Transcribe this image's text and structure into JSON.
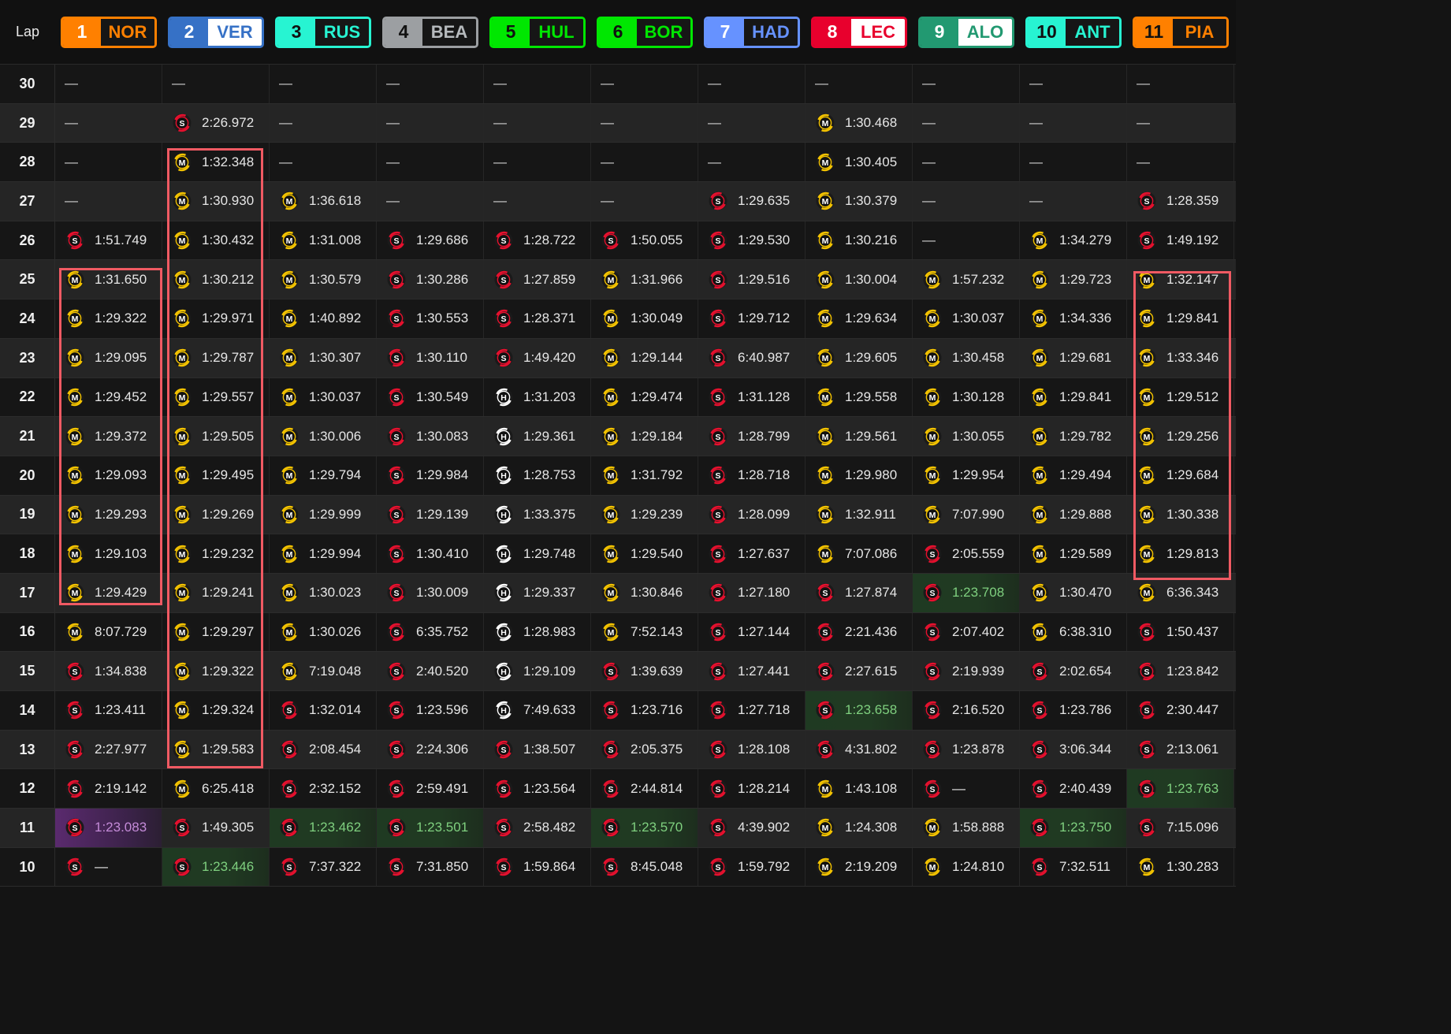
{
  "header": {
    "lap_label": "Lap"
  },
  "tyre_colors": {
    "S": "#e8102e",
    "M": "#f5c400",
    "H": "#ffffff"
  },
  "drivers": [
    {
      "pos": "1",
      "code": "NOR",
      "color": "#ff8000",
      "pos_text": "#ffffff",
      "code_text": "#ff8000"
    },
    {
      "pos": "2",
      "code": "VER",
      "color": "#3671c6",
      "pos_text": "#ffffff",
      "code_text": "#3671c6",
      "code_bg": "#ffffff"
    },
    {
      "pos": "3",
      "code": "RUS",
      "color": "#27f4d2",
      "pos_text": "#111111",
      "code_text": "#27f4d2"
    },
    {
      "pos": "4",
      "code": "BEA",
      "color": "#9c9fa2",
      "pos_text": "#111111",
      "code_text": "#b6babd"
    },
    {
      "pos": "5",
      "code": "HUL",
      "color": "#00e701",
      "pos_text": "#111111",
      "code_text": "#00e701"
    },
    {
      "pos": "6",
      "code": "BOR",
      "color": "#00e701",
      "pos_text": "#111111",
      "code_text": "#00e701"
    },
    {
      "pos": "7",
      "code": "HAD",
      "color": "#6692ff",
      "pos_text": "#ffffff",
      "code_text": "#6692ff"
    },
    {
      "pos": "8",
      "code": "LEC",
      "color": "#e8002d",
      "pos_text": "#ffffff",
      "code_text": "#e8002d",
      "code_bg": "#ffffff"
    },
    {
      "pos": "9",
      "code": "ALO",
      "color": "#229971",
      "pos_text": "#ffffff",
      "code_text": "#229971",
      "code_bg": "#ffffff"
    },
    {
      "pos": "10",
      "code": "ANT",
      "color": "#27f4d2",
      "pos_text": "#111111",
      "code_text": "#27f4d2"
    },
    {
      "pos": "11",
      "code": "PIA",
      "color": "#ff8000",
      "pos_text": "#111111",
      "code_text": "#ff8000"
    }
  ],
  "laps": [
    {
      "lap": "30",
      "cells": [
        {
          "t": "—"
        },
        {
          "t": "—"
        },
        {
          "t": "—"
        },
        {
          "t": "—"
        },
        {
          "t": "—"
        },
        {
          "t": "—"
        },
        {
          "t": "—"
        },
        {
          "t": "—"
        },
        {
          "t": "—"
        },
        {
          "t": "—"
        },
        {
          "t": "—"
        }
      ]
    },
    {
      "lap": "29",
      "cells": [
        {
          "t": "—"
        },
        {
          "tyre": "S",
          "t": "2:26.972"
        },
        {
          "t": "—"
        },
        {
          "t": "—"
        },
        {
          "t": "—"
        },
        {
          "t": "—"
        },
        {
          "t": "—"
        },
        {
          "tyre": "M",
          "t": "1:30.468"
        },
        {
          "t": "—"
        },
        {
          "t": "—"
        },
        {
          "t": "—"
        }
      ]
    },
    {
      "lap": "28",
      "cells": [
        {
          "t": "—"
        },
        {
          "tyre": "M",
          "t": "1:32.348"
        },
        {
          "t": "—"
        },
        {
          "t": "—"
        },
        {
          "t": "—"
        },
        {
          "t": "—"
        },
        {
          "t": "—"
        },
        {
          "tyre": "M",
          "t": "1:30.405"
        },
        {
          "t": "—"
        },
        {
          "t": "—"
        },
        {
          "t": "—"
        }
      ]
    },
    {
      "lap": "27",
      "cells": [
        {
          "t": "—"
        },
        {
          "tyre": "M",
          "t": "1:30.930"
        },
        {
          "tyre": "M",
          "t": "1:36.618"
        },
        {
          "t": "—"
        },
        {
          "t": "—"
        },
        {
          "t": "—"
        },
        {
          "tyre": "S",
          "t": "1:29.635"
        },
        {
          "tyre": "M",
          "t": "1:30.379"
        },
        {
          "t": "—"
        },
        {
          "t": "—"
        },
        {
          "tyre": "S",
          "t": "1:28.359"
        }
      ]
    },
    {
      "lap": "26",
      "cells": [
        {
          "tyre": "S",
          "t": "1:51.749"
        },
        {
          "tyre": "M",
          "t": "1:30.432"
        },
        {
          "tyre": "M",
          "t": "1:31.008"
        },
        {
          "tyre": "S",
          "t": "1:29.686"
        },
        {
          "tyre": "S",
          "t": "1:28.722"
        },
        {
          "tyre": "S",
          "t": "1:50.055"
        },
        {
          "tyre": "S",
          "t": "1:29.530"
        },
        {
          "tyre": "M",
          "t": "1:30.216"
        },
        {
          "t": "—"
        },
        {
          "tyre": "M",
          "t": "1:34.279"
        },
        {
          "tyre": "S",
          "t": "1:49.192"
        }
      ]
    },
    {
      "lap": "25",
      "cells": [
        {
          "tyre": "M",
          "t": "1:31.650"
        },
        {
          "tyre": "M",
          "t": "1:30.212"
        },
        {
          "tyre": "M",
          "t": "1:30.579"
        },
        {
          "tyre": "S",
          "t": "1:30.286"
        },
        {
          "tyre": "S",
          "t": "1:27.859"
        },
        {
          "tyre": "M",
          "t": "1:31.966"
        },
        {
          "tyre": "S",
          "t": "1:29.516"
        },
        {
          "tyre": "M",
          "t": "1:30.004"
        },
        {
          "tyre": "M",
          "t": "1:57.232"
        },
        {
          "tyre": "M",
          "t": "1:29.723"
        },
        {
          "tyre": "M",
          "t": "1:32.147"
        }
      ]
    },
    {
      "lap": "24",
      "cells": [
        {
          "tyre": "M",
          "t": "1:29.322"
        },
        {
          "tyre": "M",
          "t": "1:29.971"
        },
        {
          "tyre": "M",
          "t": "1:40.892"
        },
        {
          "tyre": "S",
          "t": "1:30.553"
        },
        {
          "tyre": "S",
          "t": "1:28.371"
        },
        {
          "tyre": "M",
          "t": "1:30.049"
        },
        {
          "tyre": "S",
          "t": "1:29.712"
        },
        {
          "tyre": "M",
          "t": "1:29.634"
        },
        {
          "tyre": "M",
          "t": "1:30.037"
        },
        {
          "tyre": "M",
          "t": "1:34.336"
        },
        {
          "tyre": "M",
          "t": "1:29.841"
        }
      ]
    },
    {
      "lap": "23",
      "cells": [
        {
          "tyre": "M",
          "t": "1:29.095"
        },
        {
          "tyre": "M",
          "t": "1:29.787"
        },
        {
          "tyre": "M",
          "t": "1:30.307"
        },
        {
          "tyre": "S",
          "t": "1:30.110"
        },
        {
          "tyre": "S",
          "t": "1:49.420"
        },
        {
          "tyre": "M",
          "t": "1:29.144"
        },
        {
          "tyre": "S",
          "t": "6:40.987"
        },
        {
          "tyre": "M",
          "t": "1:29.605"
        },
        {
          "tyre": "M",
          "t": "1:30.458"
        },
        {
          "tyre": "M",
          "t": "1:29.681"
        },
        {
          "tyre": "M",
          "t": "1:33.346"
        }
      ]
    },
    {
      "lap": "22",
      "cells": [
        {
          "tyre": "M",
          "t": "1:29.452"
        },
        {
          "tyre": "M",
          "t": "1:29.557"
        },
        {
          "tyre": "M",
          "t": "1:30.037"
        },
        {
          "tyre": "S",
          "t": "1:30.549"
        },
        {
          "tyre": "H",
          "t": "1:31.203"
        },
        {
          "tyre": "M",
          "t": "1:29.474"
        },
        {
          "tyre": "S",
          "t": "1:31.128"
        },
        {
          "tyre": "M",
          "t": "1:29.558"
        },
        {
          "tyre": "M",
          "t": "1:30.128"
        },
        {
          "tyre": "M",
          "t": "1:29.841"
        },
        {
          "tyre": "M",
          "t": "1:29.512"
        }
      ]
    },
    {
      "lap": "21",
      "cells": [
        {
          "tyre": "M",
          "t": "1:29.372"
        },
        {
          "tyre": "M",
          "t": "1:29.505"
        },
        {
          "tyre": "M",
          "t": "1:30.006"
        },
        {
          "tyre": "S",
          "t": "1:30.083"
        },
        {
          "tyre": "H",
          "t": "1:29.361"
        },
        {
          "tyre": "M",
          "t": "1:29.184"
        },
        {
          "tyre": "S",
          "t": "1:28.799"
        },
        {
          "tyre": "M",
          "t": "1:29.561"
        },
        {
          "tyre": "M",
          "t": "1:30.055"
        },
        {
          "tyre": "M",
          "t": "1:29.782"
        },
        {
          "tyre": "M",
          "t": "1:29.256"
        }
      ]
    },
    {
      "lap": "20",
      "cells": [
        {
          "tyre": "M",
          "t": "1:29.093"
        },
        {
          "tyre": "M",
          "t": "1:29.495"
        },
        {
          "tyre": "M",
          "t": "1:29.794"
        },
        {
          "tyre": "S",
          "t": "1:29.984"
        },
        {
          "tyre": "H",
          "t": "1:28.753"
        },
        {
          "tyre": "M",
          "t": "1:31.792"
        },
        {
          "tyre": "S",
          "t": "1:28.718"
        },
        {
          "tyre": "M",
          "t": "1:29.980"
        },
        {
          "tyre": "M",
          "t": "1:29.954"
        },
        {
          "tyre": "M",
          "t": "1:29.494"
        },
        {
          "tyre": "M",
          "t": "1:29.684"
        }
      ]
    },
    {
      "lap": "19",
      "cells": [
        {
          "tyre": "M",
          "t": "1:29.293"
        },
        {
          "tyre": "M",
          "t": "1:29.269"
        },
        {
          "tyre": "M",
          "t": "1:29.999"
        },
        {
          "tyre": "S",
          "t": "1:29.139"
        },
        {
          "tyre": "H",
          "t": "1:33.375"
        },
        {
          "tyre": "M",
          "t": "1:29.239"
        },
        {
          "tyre": "S",
          "t": "1:28.099"
        },
        {
          "tyre": "M",
          "t": "1:32.911"
        },
        {
          "tyre": "M",
          "t": "7:07.990"
        },
        {
          "tyre": "M",
          "t": "1:29.888"
        },
        {
          "tyre": "M",
          "t": "1:30.338"
        }
      ]
    },
    {
      "lap": "18",
      "cells": [
        {
          "tyre": "M",
          "t": "1:29.103"
        },
        {
          "tyre": "M",
          "t": "1:29.232"
        },
        {
          "tyre": "M",
          "t": "1:29.994"
        },
        {
          "tyre": "S",
          "t": "1:30.410"
        },
        {
          "tyre": "H",
          "t": "1:29.748"
        },
        {
          "tyre": "M",
          "t": "1:29.540"
        },
        {
          "tyre": "S",
          "t": "1:27.637"
        },
        {
          "tyre": "M",
          "t": "7:07.086"
        },
        {
          "tyre": "S",
          "t": "2:05.559"
        },
        {
          "tyre": "M",
          "t": "1:29.589"
        },
        {
          "tyre": "M",
          "t": "1:29.813"
        }
      ]
    },
    {
      "lap": "17",
      "cells": [
        {
          "tyre": "M",
          "t": "1:29.429"
        },
        {
          "tyre": "M",
          "t": "1:29.241"
        },
        {
          "tyre": "M",
          "t": "1:30.023"
        },
        {
          "tyre": "S",
          "t": "1:30.009"
        },
        {
          "tyre": "H",
          "t": "1:29.337"
        },
        {
          "tyre": "M",
          "t": "1:30.846"
        },
        {
          "tyre": "S",
          "t": "1:27.180"
        },
        {
          "tyre": "S",
          "t": "1:27.874"
        },
        {
          "tyre": "S",
          "t": "1:23.708",
          "pb": true
        },
        {
          "tyre": "M",
          "t": "1:30.470"
        },
        {
          "tyre": "M",
          "t": "6:36.343"
        }
      ]
    },
    {
      "lap": "16",
      "cells": [
        {
          "tyre": "M",
          "t": "8:07.729"
        },
        {
          "tyre": "M",
          "t": "1:29.297"
        },
        {
          "tyre": "M",
          "t": "1:30.026"
        },
        {
          "tyre": "S",
          "t": "6:35.752"
        },
        {
          "tyre": "H",
          "t": "1:28.983"
        },
        {
          "tyre": "M",
          "t": "7:52.143"
        },
        {
          "tyre": "S",
          "t": "1:27.144"
        },
        {
          "tyre": "S",
          "t": "2:21.436"
        },
        {
          "tyre": "S",
          "t": "2:07.402"
        },
        {
          "tyre": "M",
          "t": "6:38.310"
        },
        {
          "tyre": "S",
          "t": "1:50.437"
        }
      ]
    },
    {
      "lap": "15",
      "cells": [
        {
          "tyre": "S",
          "t": "1:34.838"
        },
        {
          "tyre": "M",
          "t": "1:29.322"
        },
        {
          "tyre": "M",
          "t": "7:19.048"
        },
        {
          "tyre": "S",
          "t": "2:40.520"
        },
        {
          "tyre": "H",
          "t": "1:29.109"
        },
        {
          "tyre": "S",
          "t": "1:39.639"
        },
        {
          "tyre": "S",
          "t": "1:27.441"
        },
        {
          "tyre": "S",
          "t": "2:27.615"
        },
        {
          "tyre": "S",
          "t": "2:19.939"
        },
        {
          "tyre": "S",
          "t": "2:02.654"
        },
        {
          "tyre": "S",
          "t": "1:23.842"
        }
      ]
    },
    {
      "lap": "14",
      "cells": [
        {
          "tyre": "S",
          "t": "1:23.411"
        },
        {
          "tyre": "M",
          "t": "1:29.324"
        },
        {
          "tyre": "S",
          "t": "1:32.014"
        },
        {
          "tyre": "S",
          "t": "1:23.596"
        },
        {
          "tyre": "H",
          "t": "7:49.633"
        },
        {
          "tyre": "S",
          "t": "1:23.716"
        },
        {
          "tyre": "S",
          "t": "1:27.718"
        },
        {
          "tyre": "S",
          "t": "1:23.658",
          "pb": true
        },
        {
          "tyre": "S",
          "t": "2:16.520"
        },
        {
          "tyre": "S",
          "t": "1:23.786"
        },
        {
          "tyre": "S",
          "t": "2:30.447"
        }
      ]
    },
    {
      "lap": "13",
      "cells": [
        {
          "tyre": "S",
          "t": "2:27.977"
        },
        {
          "tyre": "M",
          "t": "1:29.583"
        },
        {
          "tyre": "S",
          "t": "2:08.454"
        },
        {
          "tyre": "S",
          "t": "2:24.306"
        },
        {
          "tyre": "S",
          "t": "1:38.507"
        },
        {
          "tyre": "S",
          "t": "2:05.375"
        },
        {
          "tyre": "S",
          "t": "1:28.108"
        },
        {
          "tyre": "S",
          "t": "4:31.802"
        },
        {
          "tyre": "S",
          "t": "1:23.878"
        },
        {
          "tyre": "S",
          "t": "3:06.344"
        },
        {
          "tyre": "S",
          "t": "2:13.061"
        }
      ]
    },
    {
      "lap": "12",
      "cells": [
        {
          "tyre": "S",
          "t": "2:19.142"
        },
        {
          "tyre": "M",
          "t": "6:25.418"
        },
        {
          "tyre": "S",
          "t": "2:32.152"
        },
        {
          "tyre": "S",
          "t": "2:59.491"
        },
        {
          "tyre": "S",
          "t": "1:23.564"
        },
        {
          "tyre": "S",
          "t": "2:44.814"
        },
        {
          "tyre": "S",
          "t": "1:28.214"
        },
        {
          "tyre": "M",
          "t": "1:43.108"
        },
        {
          "tyre": "S",
          "t": "—"
        },
        {
          "tyre": "S",
          "t": "2:40.439"
        },
        {
          "tyre": "S",
          "t": "1:23.763",
          "pb": true
        }
      ]
    },
    {
      "lap": "11",
      "cells": [
        {
          "tyre": "S",
          "t": "1:23.083",
          "fl": true
        },
        {
          "tyre": "S",
          "t": "1:49.305"
        },
        {
          "tyre": "S",
          "t": "1:23.462",
          "pb": true
        },
        {
          "tyre": "S",
          "t": "1:23.501",
          "pb": true
        },
        {
          "tyre": "S",
          "t": "2:58.482"
        },
        {
          "tyre": "S",
          "t": "1:23.570",
          "pb": true
        },
        {
          "tyre": "S",
          "t": "4:39.902"
        },
        {
          "tyre": "M",
          "t": "1:24.308"
        },
        {
          "tyre": "M",
          "t": "1:58.888"
        },
        {
          "tyre": "S",
          "t": "1:23.750",
          "pb": true
        },
        {
          "tyre": "S",
          "t": "7:15.096"
        }
      ]
    },
    {
      "lap": "10",
      "cells": [
        {
          "tyre": "S",
          "t": "—"
        },
        {
          "tyre": "S",
          "t": "1:23.446",
          "pb": true
        },
        {
          "tyre": "S",
          "t": "7:37.322"
        },
        {
          "tyre": "S",
          "t": "7:31.850"
        },
        {
          "tyre": "S",
          "t": "1:59.864"
        },
        {
          "tyre": "S",
          "t": "8:45.048"
        },
        {
          "tyre": "S",
          "t": "1:59.792"
        },
        {
          "tyre": "M",
          "t": "2:19.209"
        },
        {
          "tyre": "M",
          "t": "1:24.810"
        },
        {
          "tyre": "S",
          "t": "7:32.511"
        },
        {
          "tyre": "M",
          "t": "1:30.283"
        }
      ]
    }
  ]
}
